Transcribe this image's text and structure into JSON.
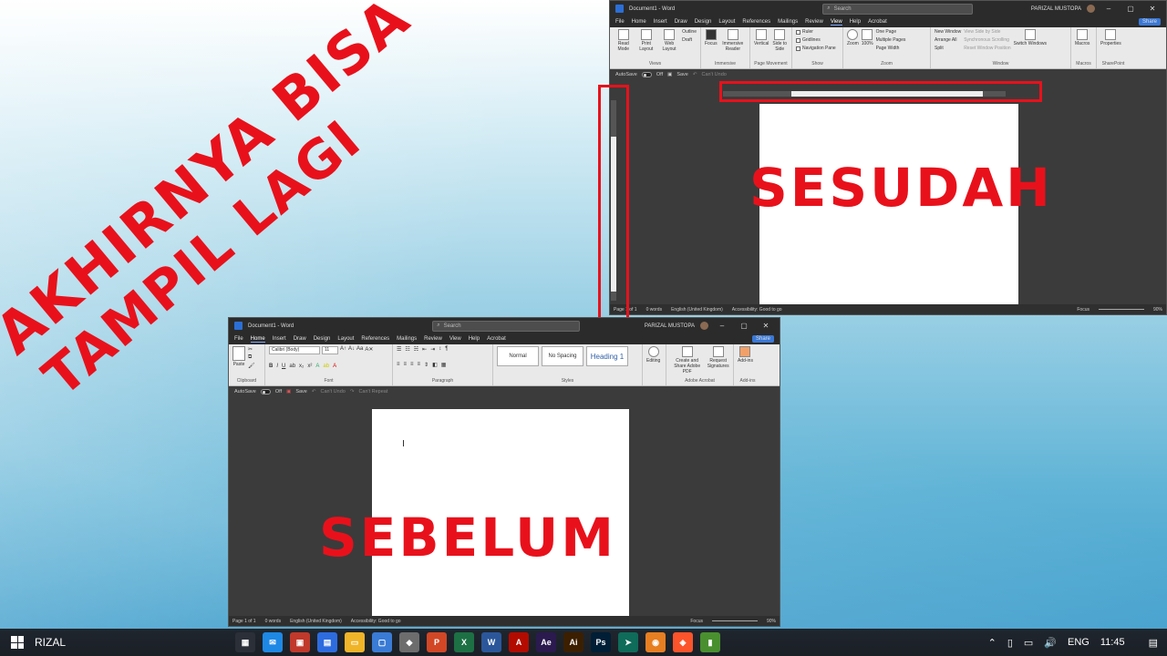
{
  "headline": {
    "line1": "AKHIRNYA BISA",
    "line2": "TAMPIL LAGI"
  },
  "captions": {
    "after": "SESUDAH",
    "before": "SEBELUM"
  },
  "after_window": {
    "title": "Document1 - Word",
    "search": "Search",
    "user": "PARIZAL MUSTOPA",
    "controls": [
      "–",
      "▢",
      "✕"
    ],
    "menu": [
      "File",
      "Home",
      "Insert",
      "Draw",
      "Design",
      "Layout",
      "References",
      "Mailings",
      "Review",
      "View",
      "Help",
      "Acrobat"
    ],
    "active_menu": "View",
    "share": "Share",
    "groups": {
      "views": {
        "label": "Views",
        "buttons": [
          "Read Mode",
          "Print Layout",
          "Web Layout"
        ],
        "small": [
          "Outline",
          "Draft"
        ]
      },
      "immersive": {
        "label": "Immersive",
        "buttons": [
          "Focus",
          "Immersive Reader"
        ]
      },
      "page_movement": {
        "label": "Page Movement",
        "buttons": [
          "Vertical",
          "Side to Side"
        ]
      },
      "show": {
        "label": "Show",
        "small": [
          "Ruler",
          "Gridlines",
          "Navigation Pane"
        ]
      },
      "zoom": {
        "label": "Zoom",
        "buttons": [
          "Zoom",
          "100%"
        ],
        "small": [
          "One Page",
          "Multiple Pages",
          "Page Width"
        ]
      },
      "window": {
        "label": "Window",
        "small": [
          "New Window",
          "Arrange All",
          "Split"
        ],
        "dim": [
          "View Side by Side",
          "Synchronous Scrolling",
          "Reset Window Position"
        ],
        "buttons": [
          "Switch Windows"
        ]
      },
      "macros": {
        "label": "Macros",
        "buttons": [
          "Macros"
        ]
      },
      "sharepoint": {
        "label": "SharePoint",
        "buttons": [
          "Properties"
        ]
      }
    },
    "qat": {
      "autosave": "AutoSave",
      "off": "Off",
      "save": "Save",
      "undo": "Can't Undo"
    },
    "status": {
      "page": "Page 1 of 1",
      "words": "0 words",
      "lang": "English (United Kingdom)",
      "access": "Accessibility: Good to go",
      "focus": "Focus",
      "zoom": "90%"
    }
  },
  "before_window": {
    "title": "Document1 - Word",
    "search": "Search",
    "user": "PARIZAL MUSTOPA",
    "controls": [
      "–",
      "▢",
      "✕"
    ],
    "menu": [
      "File",
      "Home",
      "Insert",
      "Draw",
      "Design",
      "Layout",
      "References",
      "Mailings",
      "Review",
      "View",
      "Help",
      "Acrobat"
    ],
    "active_menu": "Home",
    "share": "Share",
    "font": "Calibri (Body)",
    "size": "11",
    "groups": {
      "clipboard": {
        "label": "Clipboard",
        "paste": "Paste"
      },
      "font": {
        "label": "Font"
      },
      "paragraph": {
        "label": "Paragraph"
      },
      "styles": {
        "label": "Styles",
        "items": [
          "Normal",
          "No Spacing",
          "Heading 1"
        ]
      },
      "editing": {
        "label": "Editing"
      },
      "adobe": {
        "label": "Adobe Acrobat",
        "buttons": [
          "Create and Share Adobe PDF",
          "Request Signatures"
        ]
      },
      "addins": {
        "label": "Add-ins",
        "buttons": [
          "Add-ins"
        ]
      }
    },
    "qat": {
      "autosave": "AutoSave",
      "off": "Off",
      "save": "Save",
      "undo": "Can't Undo",
      "redo": "Can't Repeat"
    },
    "status": {
      "page": "Page 1 of 1",
      "words": "0 words",
      "lang": "English (United Kingdom)",
      "access": "Accessibility: Good to go",
      "focus": "Focus",
      "zoom": "90%"
    }
  },
  "taskbar": {
    "user": "RIZAL",
    "lang": "ENG",
    "time": "11:45",
    "apps": [
      {
        "name": "start-menu",
        "glyph": "▦",
        "color": "#2a2f38"
      },
      {
        "name": "mail",
        "glyph": "✉",
        "color": "#1e88e5"
      },
      {
        "name": "app-red",
        "glyph": "▣",
        "color": "#c0392b"
      },
      {
        "name": "app-blue",
        "glyph": "▤",
        "color": "#2d6cdf"
      },
      {
        "name": "file-explorer",
        "glyph": "▭",
        "color": "#f0b429"
      },
      {
        "name": "app-window",
        "glyph": "▢",
        "color": "#3a7bd5"
      },
      {
        "name": "photos",
        "glyph": "◆",
        "color": "#6d6d6d"
      },
      {
        "name": "powerpoint",
        "glyph": "P",
        "color": "#d24726"
      },
      {
        "name": "excel",
        "glyph": "X",
        "color": "#1d7044"
      },
      {
        "name": "word",
        "glyph": "W",
        "color": "#2b579a"
      },
      {
        "name": "acrobat",
        "glyph": "A",
        "color": "#b30b00"
      },
      {
        "name": "after-effects",
        "glyph": "Ae",
        "color": "#2a1a4e"
      },
      {
        "name": "illustrator",
        "glyph": "Ai",
        "color": "#3b1f00"
      },
      {
        "name": "photoshop",
        "glyph": "Ps",
        "color": "#001e36"
      },
      {
        "name": "app-arrow",
        "glyph": "➤",
        "color": "#0f6b5a"
      },
      {
        "name": "app-orange",
        "glyph": "◉",
        "color": "#e67e22"
      },
      {
        "name": "brave",
        "glyph": "◈",
        "color": "#fb542b"
      },
      {
        "name": "app-green",
        "glyph": "▮",
        "color": "#4a8f2f"
      }
    ]
  }
}
